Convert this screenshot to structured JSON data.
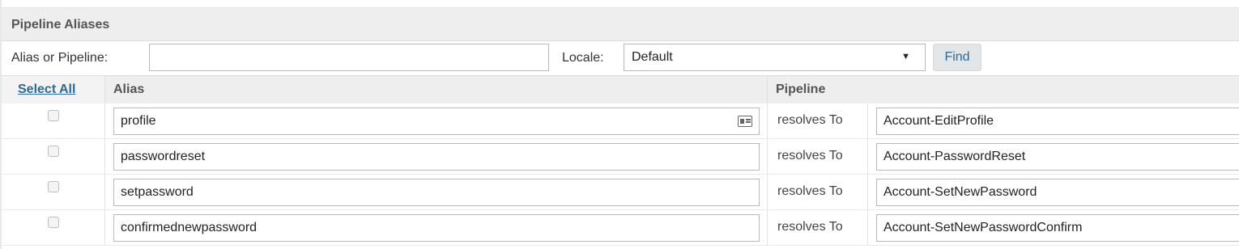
{
  "panel": {
    "title": "Pipeline Aliases"
  },
  "filter": {
    "alias_label": "Alias or Pipeline:",
    "alias_value": "",
    "locale_label": "Locale:",
    "locale_value": "Default",
    "find_label": "Find"
  },
  "table": {
    "select_all": "Select All",
    "col_alias": "Alias",
    "col_pipeline": "Pipeline",
    "rows": [
      {
        "alias": "profile",
        "resolves": "resolves To",
        "pipeline": "Account-EditProfile"
      },
      {
        "alias": "passwordreset",
        "resolves": "resolves To",
        "pipeline": "Account-PasswordReset"
      },
      {
        "alias": "setpassword",
        "resolves": "resolves To",
        "pipeline": "Account-SetNewPassword"
      },
      {
        "alias": "confirmednewpassword",
        "resolves": "resolves To",
        "pipeline": "Account-SetNewPasswordConfirm"
      }
    ]
  },
  "icons": {
    "row0_field_icon": "contact-card-icon",
    "dropdown_icon": "dropdown-arrow-icon"
  },
  "colors": {
    "link": "#2d6a97",
    "header_bg": "#eeeeee"
  }
}
